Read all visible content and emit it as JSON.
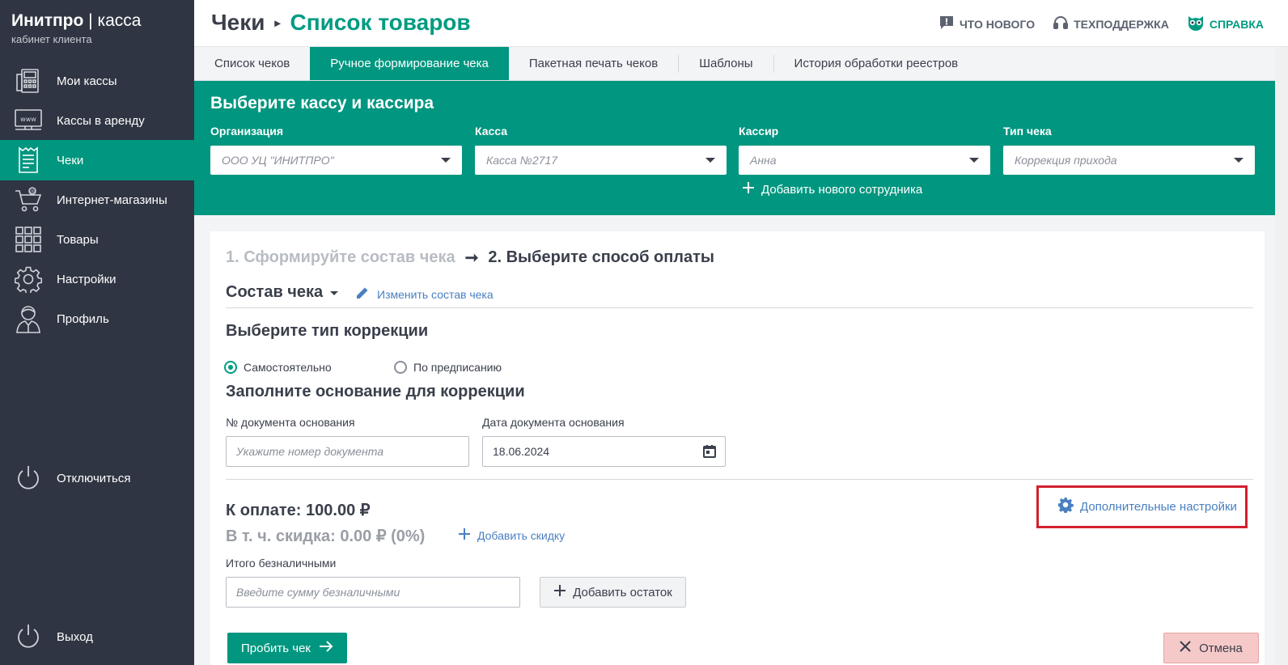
{
  "brand": {
    "name": "Инитпро",
    "separator": " | ",
    "product": "касса",
    "subtitle": "кабинет клиента"
  },
  "sidebar": {
    "items": [
      {
        "label": "Мои кассы",
        "icon": "cash-register-icon",
        "active": false
      },
      {
        "label": "Кассы в аренду",
        "icon": "www-icon",
        "active": false
      },
      {
        "label": "Чеки",
        "icon": "receipt-icon",
        "active": true
      },
      {
        "label": "Интернет-магазины",
        "icon": "cart-icon",
        "active": false
      },
      {
        "label": "Товары",
        "icon": "grid-icon",
        "active": false
      },
      {
        "label": "Настройки",
        "icon": "gear-icon",
        "active": false
      },
      {
        "label": "Профиль",
        "icon": "user-icon",
        "active": false
      }
    ],
    "disconnect": "Отключиться",
    "logout": "Выход"
  },
  "header": {
    "crumb_parent": "Чеки",
    "crumb_sep": "▸",
    "crumb_current": "Список товаров",
    "links": {
      "news": "ЧТО НОВОГО",
      "support": "ТЕХПОДДЕРЖКА",
      "help": "СПРАВКА"
    }
  },
  "tabs": [
    {
      "label": "Список чеков",
      "active": false
    },
    {
      "label": "Ручное формирование чека",
      "active": true
    },
    {
      "label": "Пакетная печать чеков",
      "active": false
    },
    {
      "label": "Шаблоны",
      "active": false
    },
    {
      "label": "История обработки реестров",
      "active": false
    }
  ],
  "band": {
    "title": "Выберите кассу и кассира",
    "org": {
      "label": "Организация",
      "value": "ООО УЦ \"ИНИТПРО\""
    },
    "cash": {
      "label": "Касса",
      "value": "Касса №2717"
    },
    "cashier": {
      "label": "Кассир",
      "value": "Анна"
    },
    "receipt_type": {
      "label": "Тип чека",
      "value": "Коррекция прихода"
    },
    "add_employee": "Добавить нового сотрудника"
  },
  "steps": {
    "step1": "1. Сформируйте состав чека",
    "arrow": "➞",
    "step2": "2. Выберите способ оплаты"
  },
  "compose": {
    "title": "Состав чека",
    "edit": "Изменить состав чека"
  },
  "correction": {
    "title": "Выберите тип коррекции",
    "options": [
      {
        "label": "Самостоятельно",
        "checked": true
      },
      {
        "label": "По предписанию",
        "checked": false
      }
    ]
  },
  "basis": {
    "title": "Заполните основание для коррекции",
    "doc_no_label": "№ документа основания",
    "doc_no_placeholder": "Укажите номер документа",
    "doc_date_label": "Дата документа основания",
    "doc_date_value": "18.06.2024"
  },
  "payment": {
    "total": "К оплате: 100.00 ₽",
    "discount": "В т. ч. скидка: 0.00 ₽ (0%)",
    "add_discount": "Добавить скидку",
    "advanced": "Дополнительные настройки",
    "cashless_label": "Итого безналичными",
    "cashless_placeholder": "Введите сумму безналичными",
    "add_rest": "Добавить остаток"
  },
  "actions": {
    "submit": "Пробить чек",
    "cancel": "Отмена"
  },
  "colors": {
    "sidebar": "#2f3542",
    "accent": "#00967f",
    "link": "#4a7fc1",
    "highlight": "#d2202f"
  }
}
